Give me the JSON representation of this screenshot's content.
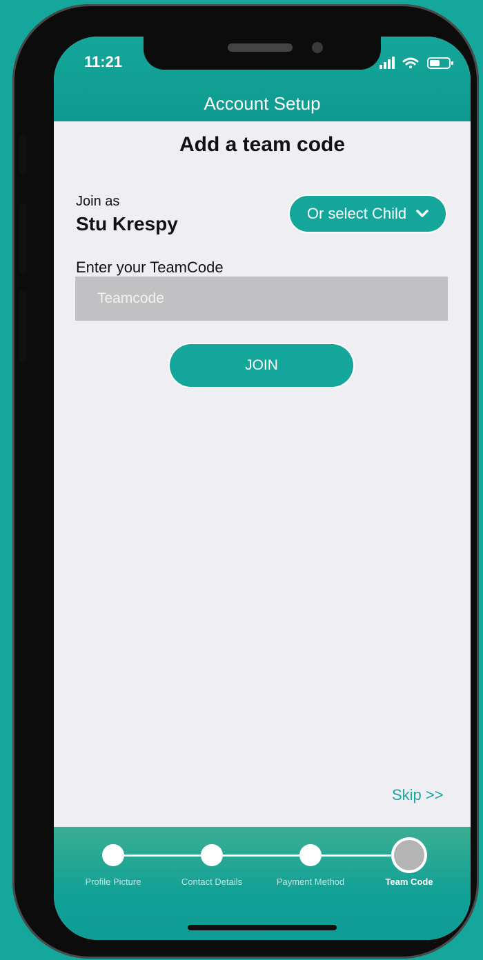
{
  "status_bar": {
    "time": "11:21"
  },
  "header": {
    "title": "Account Setup"
  },
  "page": {
    "title": "Add a team code"
  },
  "join_as": {
    "label": "Join as",
    "name": "Stu Krespy"
  },
  "select_child": {
    "label": "Or select Child"
  },
  "teamcode": {
    "label": "Enter your TeamCode",
    "placeholder": "Teamcode",
    "value": ""
  },
  "join_button": {
    "label": "JOIN"
  },
  "skip": {
    "label": "Skip >>"
  },
  "stepper": {
    "steps": [
      {
        "label": "Profile Picture"
      },
      {
        "label": "Contact Details"
      },
      {
        "label": "Payment Method"
      },
      {
        "label": "Team Code"
      }
    ],
    "active_step": "Team Code"
  },
  "colors": {
    "accent": "#14a69a",
    "background": "#16a79c",
    "screen": "#efeff3"
  }
}
